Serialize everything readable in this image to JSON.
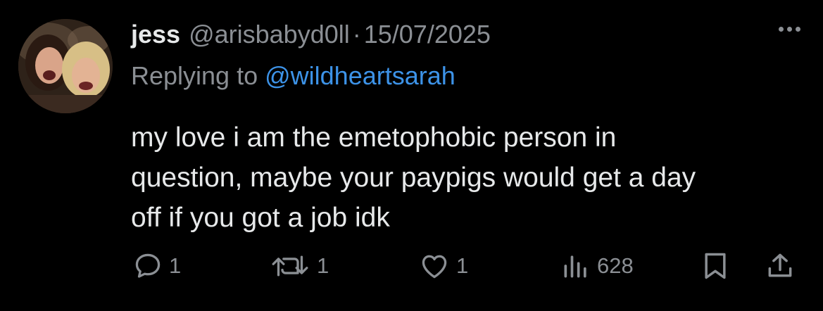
{
  "tweet": {
    "author_name": "jess",
    "author_handle": "@arisbabyd0ll",
    "separator": "·",
    "date": "15/07/2025",
    "reply_prefix": "Replying to",
    "reply_to_handle": "@wildheartsarah",
    "text_lines": [
      "my love i am the emetophobic person in",
      "question, maybe your paypigs would get a day",
      "off if you got a job idk"
    ]
  },
  "actions": {
    "replies": "1",
    "reposts": "1",
    "likes": "1",
    "views": "628"
  },
  "colors": {
    "background": "#000000",
    "primary_text": "#e7e9ea",
    "secondary_text": "#8b8f94",
    "link": "#3d93e8"
  },
  "icons": {
    "reply": "reply-bubble-icon",
    "repost": "repost-icon",
    "like": "heart-icon",
    "views": "bar-chart-icon",
    "bookmark": "bookmark-icon",
    "share": "share-icon",
    "more": "more-dots-icon"
  }
}
